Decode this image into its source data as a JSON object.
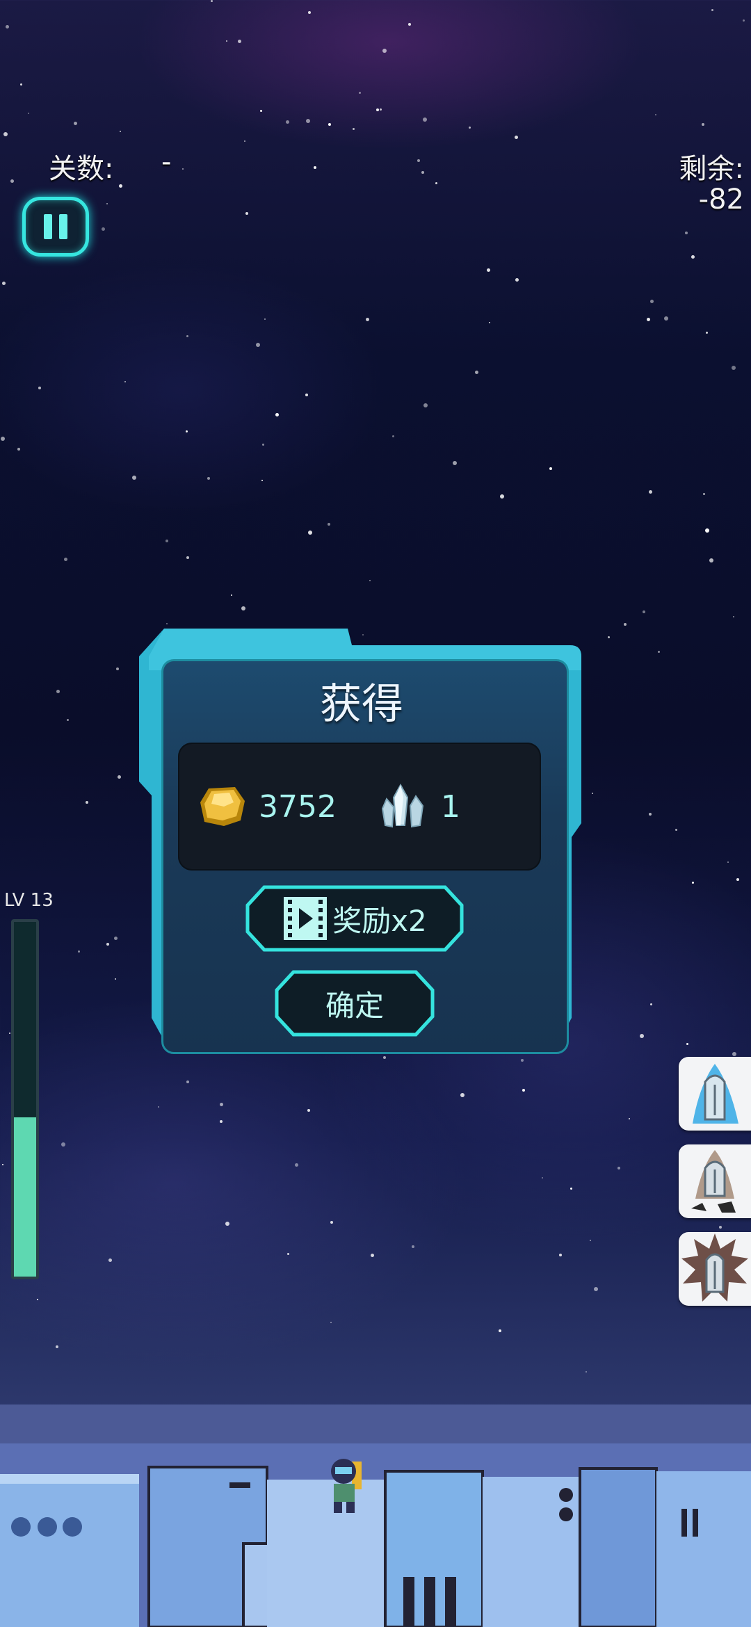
{
  "hud": {
    "level_label": "关数:",
    "level_value": "-",
    "remaining_label": "剩余:",
    "remaining_value": "-82"
  },
  "dialog": {
    "title": "获得",
    "rewards": [
      {
        "icon": "gold-nugget-icon",
        "value": "3752"
      },
      {
        "icon": "crystal-icon",
        "value": "1"
      }
    ],
    "double_reward_label": "奖励x2",
    "double_reward_icon": "video-play-icon",
    "confirm_label": "确定"
  },
  "level_progress": {
    "label": "LV 13",
    "fill_fraction": 0.45,
    "fill_color": "#5ed8b1"
  },
  "skills": [
    {
      "name": "ice-bullet-skill",
      "icon": "ice-bullet-icon"
    },
    {
      "name": "rock-bullet-skill",
      "icon": "rock-bullet-icon"
    },
    {
      "name": "blast-bullet-skill",
      "icon": "blast-bullet-icon"
    }
  ],
  "colors": {
    "accent": "#36e6e0",
    "dialog_frame": "#2fb6d2",
    "reward_text": "#a9f4ef"
  }
}
